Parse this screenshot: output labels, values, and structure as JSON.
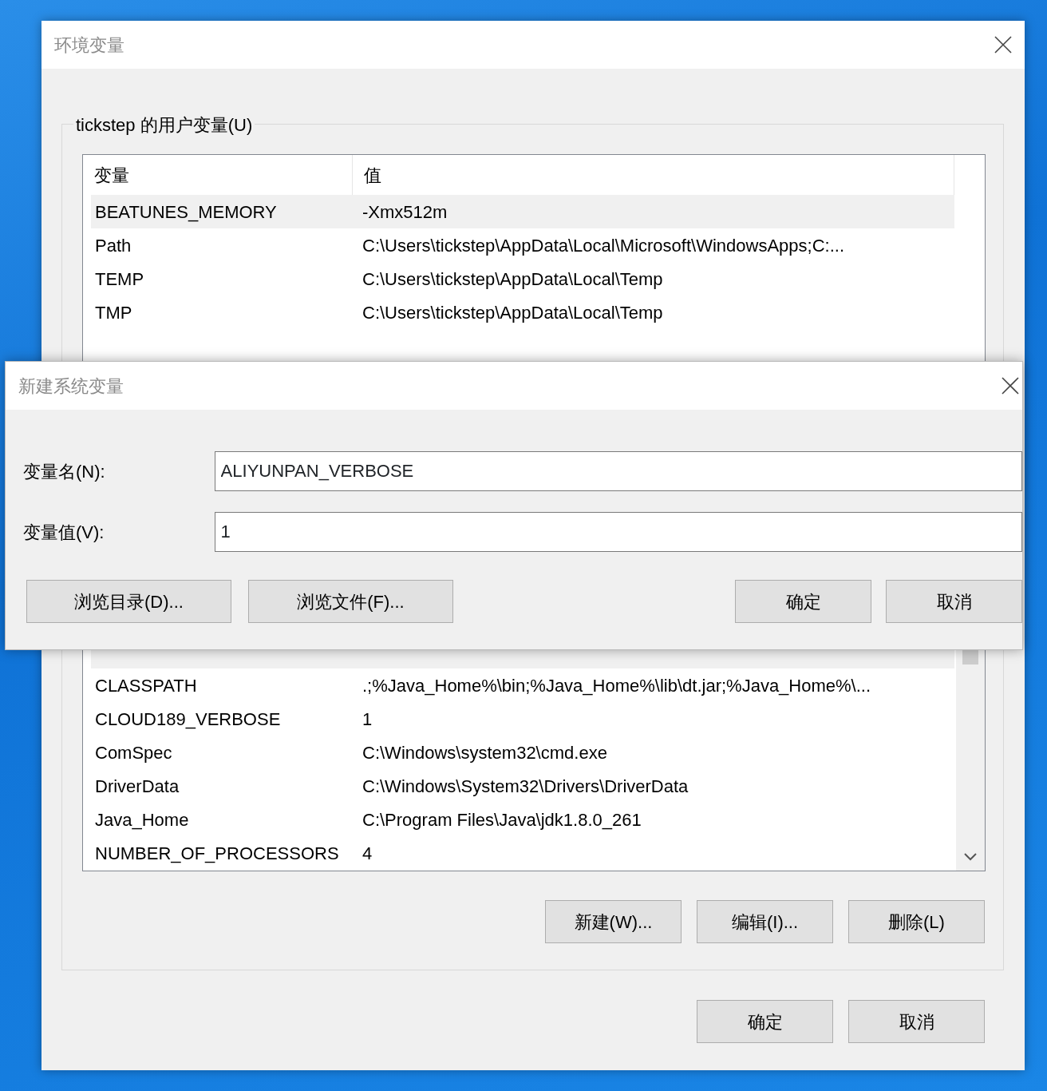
{
  "main_window": {
    "title": "环境变量",
    "user_group": {
      "title": "tickstep 的用户变量(U)",
      "columns": [
        "变量",
        "值"
      ],
      "rows": [
        {
          "name": "BEATUNES_MEMORY",
          "value": "-Xmx512m",
          "selected": true
        },
        {
          "name": "Path",
          "value": "C:\\Users\\tickstep\\AppData\\Local\\Microsoft\\WindowsApps;C:...",
          "selected": false
        },
        {
          "name": "TEMP",
          "value": "C:\\Users\\tickstep\\AppData\\Local\\Temp",
          "selected": false
        },
        {
          "name": "TMP",
          "value": "C:\\Users\\tickstep\\AppData\\Local\\Temp",
          "selected": false
        }
      ]
    },
    "system_group": {
      "rows": [
        {
          "name": "CLASSPATH",
          "value": ".;%Java_Home%\\bin;%Java_Home%\\lib\\dt.jar;%Java_Home%\\...",
          "selected": false
        },
        {
          "name": "CLOUD189_VERBOSE",
          "value": "1",
          "selected": false
        },
        {
          "name": "ComSpec",
          "value": "C:\\Windows\\system32\\cmd.exe",
          "selected": false
        },
        {
          "name": "DriverData",
          "value": "C:\\Windows\\System32\\Drivers\\DriverData",
          "selected": false
        },
        {
          "name": "Java_Home",
          "value": "C:\\Program Files\\Java\\jdk1.8.0_261",
          "selected": false
        },
        {
          "name": "NUMBER_OF_PROCESSORS",
          "value": "4",
          "selected": false
        }
      ],
      "buttons": [
        "新建(W)...",
        "编辑(I)...",
        "删除(L)"
      ]
    },
    "buttons": [
      "确定",
      "取消"
    ]
  },
  "dialog": {
    "title": "新建系统变量",
    "fields": [
      {
        "label": "变量名(N):",
        "value": "ALIYUNPAN_VERBOSE"
      },
      {
        "label": "变量值(V):",
        "value": "1"
      }
    ],
    "left_buttons": [
      "浏览目录(D)...",
      "浏览文件(F)..."
    ],
    "right_buttons": [
      "确定",
      "取消"
    ]
  }
}
